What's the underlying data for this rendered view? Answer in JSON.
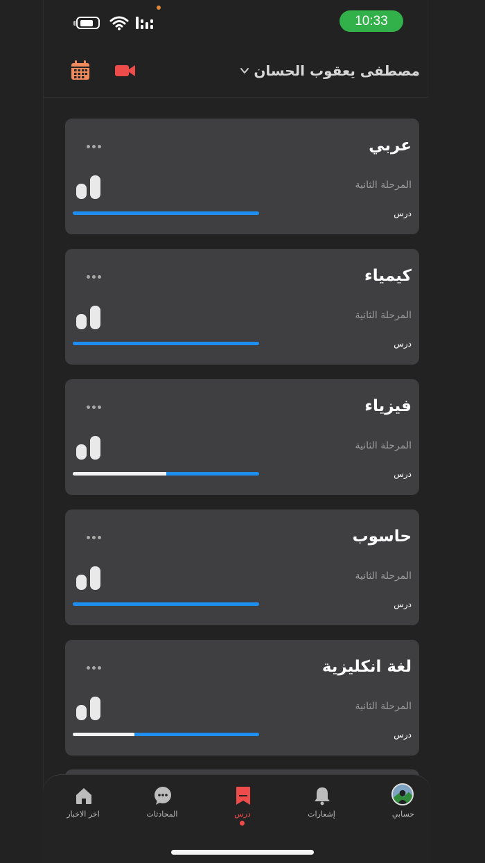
{
  "status_bar": {
    "time": "10:33",
    "time_pill_color": "#32b04a"
  },
  "header": {
    "user_name": "مصطفى يعقوب الحسان",
    "calendar_icon": "calendar-icon",
    "video_icon": "video-camera-icon"
  },
  "courses": [
    {
      "title": "عربي",
      "stage": "المرحلة الثانية",
      "lesson_label": "درس",
      "progress": 0.0
    },
    {
      "title": "كيمياء",
      "stage": "المرحلة الثانية",
      "lesson_label": "درس",
      "progress": 0.0
    },
    {
      "title": "فيزياء",
      "stage": "المرحلة الثانية",
      "lesson_label": "درس",
      "progress": 0.5
    },
    {
      "title": "حاسوب",
      "stage": "المرحلة الثانية",
      "lesson_label": "درس",
      "progress": 0.0
    },
    {
      "title": "لغة انكليزية",
      "stage": "المرحلة الثانية",
      "lesson_label": "درس",
      "progress": 0.33
    }
  ],
  "tabs": [
    {
      "label": "اخر الاخبار",
      "icon": "home-icon",
      "active": false
    },
    {
      "label": "المحادثات",
      "icon": "chat-bubble-icon",
      "active": false
    },
    {
      "label": "درس",
      "icon": "bookmark-icon",
      "active": true
    },
    {
      "label": "إشعارات",
      "icon": "bell-icon",
      "active": false
    },
    {
      "label": "حسابي",
      "icon": "avatar-icon",
      "active": false
    }
  ],
  "colors": {
    "accent": "#ee4b4b",
    "progress": "#1f8ef1",
    "calendar": "#f08a5d",
    "background": "#222222",
    "card": "#3f3f41"
  }
}
